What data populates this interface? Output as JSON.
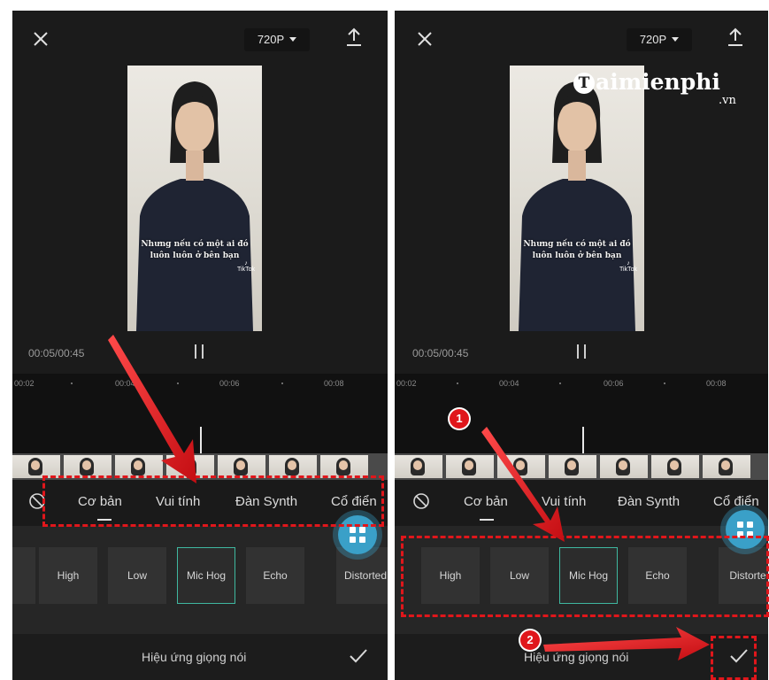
{
  "left_panel": {
    "resolution": "720P",
    "timecode": "00:05/00:45",
    "ruler_ticks": [
      "00:02",
      "00:04",
      "00:06",
      "00:08"
    ],
    "categories": [
      "Cơ bản",
      "Vui tính",
      "Đàn Synth",
      "Cổ điển"
    ],
    "effects": [
      "High",
      "Low",
      "Mic Hog",
      "Echo",
      "Distorted"
    ],
    "selected_effect": "Mic Hog",
    "bottom_label": "Hiệu ứng giọng nói"
  },
  "right_panel": {
    "resolution": "720P",
    "timecode": "00:05/00:45",
    "ruler_ticks": [
      "00:02",
      "00:04",
      "00:06",
      "00:08"
    ],
    "categories": [
      "Cơ bản",
      "Vui tính",
      "Đàn Synth",
      "Cổ điển"
    ],
    "effects": [
      "High",
      "Low",
      "Mic Hog",
      "Echo",
      "Distorte"
    ],
    "selected_effect": "Mic Hog",
    "bottom_label": "Hiệu ứng giọng nói"
  },
  "video": {
    "caption_line1": "Nhưng nếu có một ai đó",
    "caption_line2": "luôn luôn ở bên bạn",
    "watermark": "TikTok"
  },
  "annotations": {
    "step1": "1",
    "step2": "2",
    "highlight_color": "#e0161b"
  },
  "logo": {
    "initial": "T",
    "text": "aimienphi",
    "suffix": ".vn"
  },
  "icons": [
    "close-icon",
    "export-icon",
    "pause-icon",
    "no-effect-icon",
    "grid-icon",
    "check-icon"
  ]
}
